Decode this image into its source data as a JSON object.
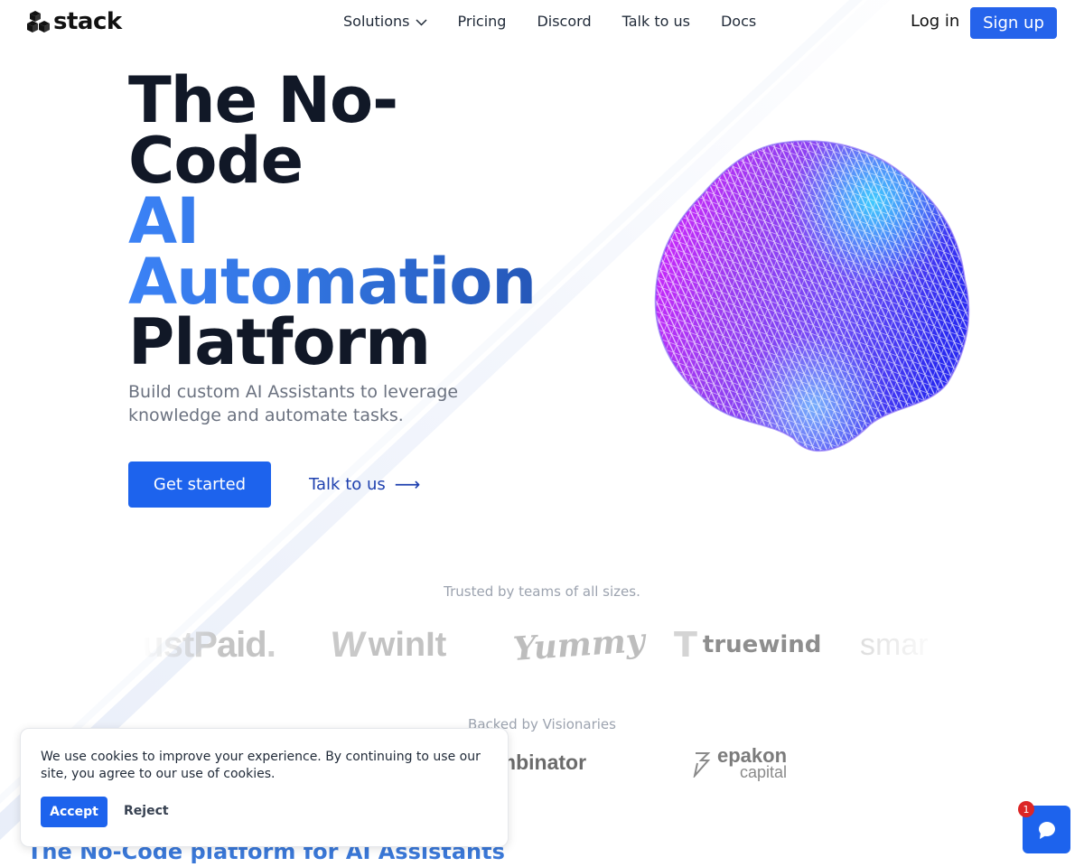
{
  "header": {
    "logo_text": "stack",
    "nav": [
      {
        "label": "Solutions",
        "has_dropdown": true
      },
      {
        "label": "Pricing"
      },
      {
        "label": "Discord"
      },
      {
        "label": "Talk to us"
      },
      {
        "label": "Docs"
      }
    ],
    "login_label": "Log in",
    "signup_label": "Sign up"
  },
  "hero": {
    "title_line1": "The No-",
    "title_line2": "Code",
    "title_line3": "AI",
    "title_line4": "Automation",
    "title_line5": "Platform",
    "subtitle": "Build custom AI Assistants to leverage knowledge and automate tasks.",
    "primary_cta": "Get started",
    "secondary_cta": "Talk to us",
    "secondary_arrow": "⟶"
  },
  "trusted": {
    "label": "Trusted by teams of all sizes.",
    "logos": [
      {
        "name": "JustPaid",
        "visible_text": "JustPaid",
        "suffix": "."
      },
      {
        "name": "winIt",
        "visible_text": "winIt",
        "mark": "W"
      },
      {
        "name": "Yummy",
        "visible_text": "Yummy"
      },
      {
        "name": "truewind",
        "visible_text": "truewind",
        "mark": "T"
      },
      {
        "name": "smart",
        "visible_text": "smar"
      }
    ]
  },
  "backed": {
    "label": "Backed by Visionaries",
    "logos": [
      {
        "name": "Y Combinator",
        "visible_text": "Combinator"
      },
      {
        "name": "epakon capital",
        "line1": "epakon",
        "line2": "capital"
      }
    ]
  },
  "next_section": {
    "heading": "The No-Code platform for AI Assistants"
  },
  "cookie_banner": {
    "text": "We use cookies to improve your experience. By continuing to use our site, you agree to our use of cookies.",
    "accept_label": "Accept",
    "reject_label": "Reject"
  },
  "chat_widget": {
    "badge_count": "1",
    "icon": "chat-bubble-icon"
  },
  "colors": {
    "primary": "#1d63ed",
    "heading_dark": "#111827",
    "heading_blue": "#3b82f6",
    "muted": "#9ca3af",
    "badge": "#dc2626"
  }
}
